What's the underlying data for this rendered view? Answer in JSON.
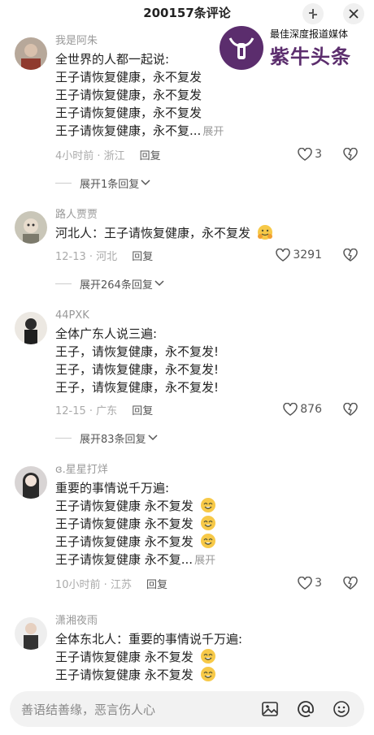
{
  "header": {
    "title": "200157条评论",
    "collapse_icon": "collapse-icon",
    "close_icon": "close-icon"
  },
  "watermark": {
    "sub": "最佳深度报道媒体",
    "main": "紫牛头条"
  },
  "comments": [
    {
      "user": "我是阿朱",
      "lines": [
        "全世界的人都一起说:",
        "王子请恢复健康，永不复发",
        "王子请恢复健康，永不复发",
        "王子请恢复健康，永不复发",
        "王子请恢复健康，永不复..."
      ],
      "expand": "展开",
      "meta": "4小时前 · 浙江",
      "reply": "回复",
      "likes": "3",
      "more": "展开1条回复"
    },
    {
      "user": "路人贾贾",
      "lines": [
        "河北人：王子请恢复健康，永不复发"
      ],
      "meta": "12-13 · 河北",
      "reply": "回复",
      "likes": "3291",
      "more": "展开264条回复"
    },
    {
      "user": "44PXK",
      "lines": [
        "全体广东人说三遍:",
        "王子，请恢复健康，永不复发!",
        "王子，请恢复健康，永不复发!",
        "王子，请恢复健康，永不复发!"
      ],
      "meta": "12-15 · 广东",
      "reply": "回复",
      "likes": "876",
      "more": "展开83条回复"
    },
    {
      "user": "ɞ.星星打烊",
      "lines": [
        "重要的事情说千万遍:",
        "王子请恢复健康 永不复发",
        "王子请恢复健康 永不复发",
        "王子请恢复健康 永不复发",
        "王子请恢复健康 永不复..."
      ],
      "expand": "展开",
      "meta": "10小时前 · 江苏",
      "reply": "回复",
      "likes": "3"
    },
    {
      "user": "潇湘夜雨",
      "lines": [
        "全体东北人：重要的事情说千万遍:",
        "王子请恢复健康 永不复发",
        "王子请恢复健康 永不复发"
      ]
    }
  ],
  "input": {
    "placeholder": "善语结善缘，恶言伤人心"
  },
  "bottom_icons": [
    "image-icon",
    "at-icon",
    "emoji-icon"
  ]
}
